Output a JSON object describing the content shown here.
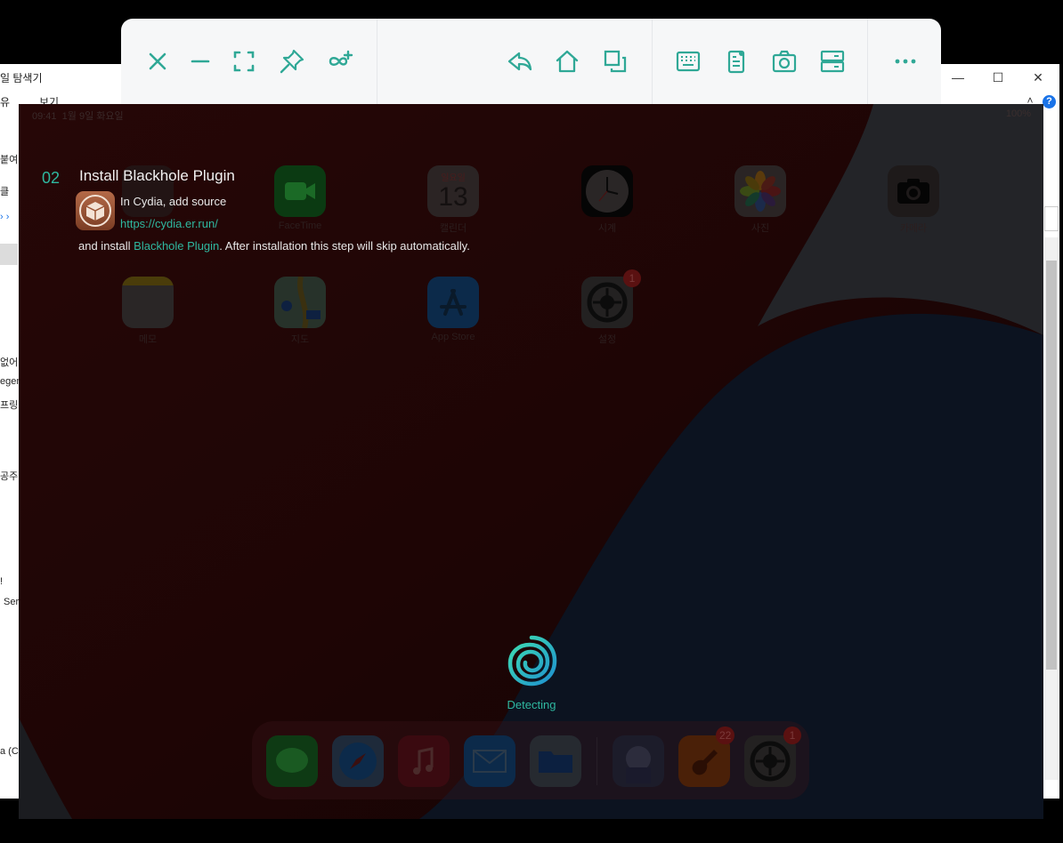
{
  "explorer": {
    "title": "일 탐색기",
    "menu": [
      "유",
      "보기"
    ],
    "side_texts": [
      "붙여",
      "클",
      "없어",
      "egen",
      "프링",
      "공주",
      "!",
      "Ser",
      "a (C"
    ]
  },
  "toolbar": {
    "left_icons": [
      "close-icon",
      "minimize-icon",
      "fullscreen-icon",
      "pin-icon",
      "infinity-plus-icon"
    ],
    "mid_icons": [
      "back-icon",
      "home-icon",
      "app-switch-icon"
    ],
    "right_icons": [
      "keyboard-icon",
      "device-info-icon",
      "screenshot-icon",
      "record-icon"
    ],
    "more_icon": "more-icon",
    "accent": "#2fa896"
  },
  "device": {
    "status_time": "09:41",
    "status_date": "1월 9일 화요일",
    "status_right": "100%",
    "apps_row1": [
      {
        "label": "",
        "icon": "blocked-icon"
      },
      {
        "label": "FaceTime",
        "icon": "facetime-icon"
      },
      {
        "label": "캘린더",
        "icon": "calendar-icon",
        "day": "일요일",
        "date": "13"
      },
      {
        "label": "시계",
        "icon": "clock-icon"
      },
      {
        "label": "사진",
        "icon": "photos-icon"
      },
      {
        "label": "카메라",
        "icon": "camera-icon"
      }
    ],
    "apps_row2": [
      {
        "label": "메모",
        "icon": "notes-icon"
      },
      {
        "label": "지도",
        "icon": "maps-icon"
      },
      {
        "label": "App Store",
        "icon": "appstore-icon"
      },
      {
        "label": "설정",
        "icon": "settings-icon",
        "badge": "1"
      }
    ],
    "dock": [
      {
        "icon": "messages-icon"
      },
      {
        "icon": "safari-icon"
      },
      {
        "icon": "music-icon"
      },
      {
        "icon": "mail-icon"
      },
      {
        "icon": "files-icon"
      },
      {
        "icon": "game-icon"
      },
      {
        "icon": "garageband-icon",
        "badge": "22"
      },
      {
        "icon": "settings-icon",
        "badge": "1"
      }
    ]
  },
  "step": {
    "number": "02",
    "title": "Install Blackhole Plugin",
    "line1": "In Cydia, add source",
    "link": "https://cydia.er.run/",
    "line3_prefix": "and install ",
    "line3_highlight": "Blackhole Plugin",
    "line3_suffix": ". After installation this step will skip automatically."
  },
  "detecting": {
    "label": "Detecting"
  }
}
